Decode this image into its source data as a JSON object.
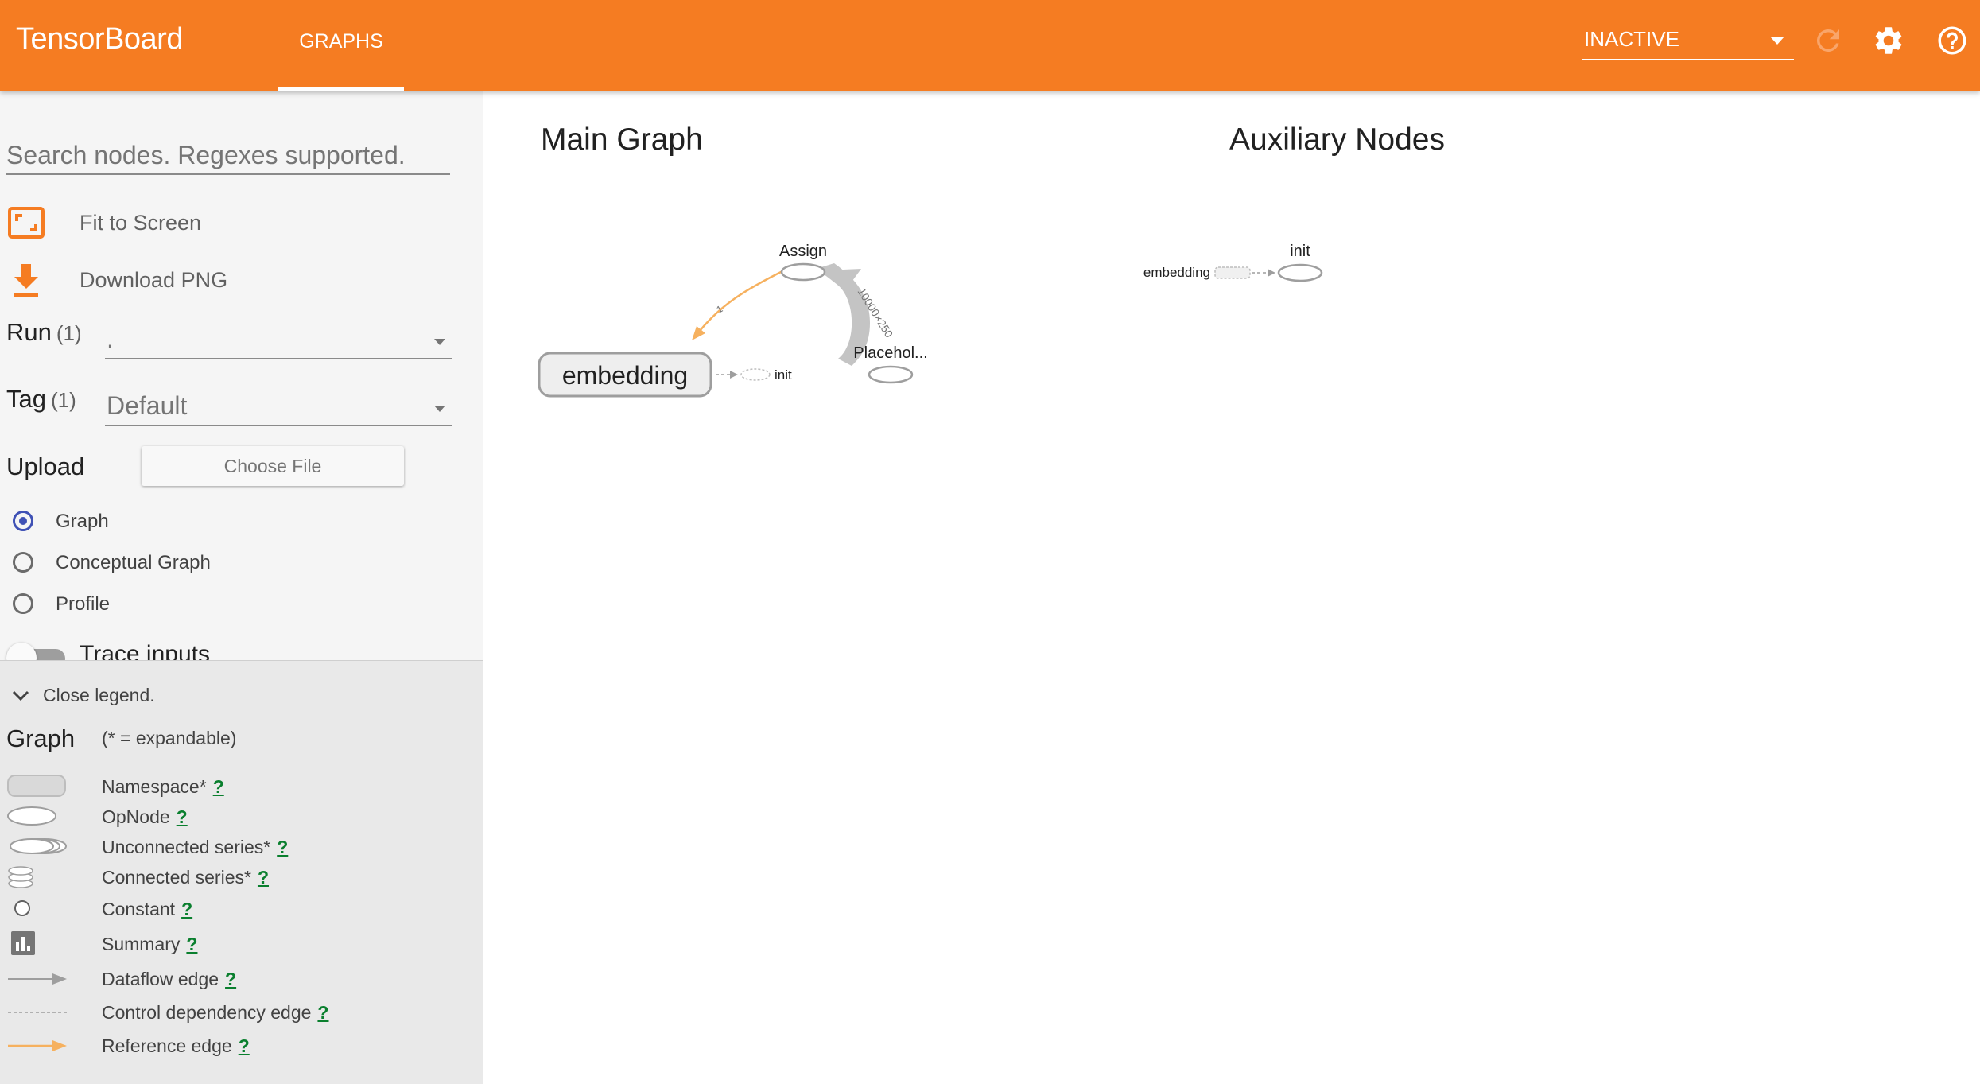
{
  "app": {
    "title": "TensorBoard"
  },
  "tabs": [
    {
      "label": "GRAPHS",
      "active": true
    }
  ],
  "topbar": {
    "run_selector": "INACTIVE",
    "icons": [
      "reload-icon",
      "settings-icon",
      "help-icon"
    ]
  },
  "sidebar": {
    "search_placeholder": "Search nodes. Regexes supported.",
    "fit_to_screen": "Fit to Screen",
    "download_png": "Download PNG",
    "run": {
      "label": "Run",
      "count": "(1)",
      "value": "."
    },
    "tag": {
      "label": "Tag",
      "count": "(1)",
      "value": "Default"
    },
    "upload": {
      "label": "Upload",
      "button": "Choose File"
    },
    "graph_types": [
      {
        "label": "Graph",
        "selected": true
      },
      {
        "label": "Conceptual Graph",
        "selected": false
      },
      {
        "label": "Profile",
        "selected": false
      }
    ],
    "trace_inputs": "Trace inputs"
  },
  "legend": {
    "toggle": "Close legend.",
    "title": "Graph",
    "subtitle": "(* = expandable)",
    "help_mark": "?",
    "items": [
      {
        "label": "Namespace*",
        "symbol": "namespace"
      },
      {
        "label": "OpNode",
        "symbol": "opnode"
      },
      {
        "label": "Unconnected series*",
        "symbol": "unconnected-series"
      },
      {
        "label": "Connected series*",
        "symbol": "connected-series"
      },
      {
        "label": "Constant",
        "symbol": "constant"
      },
      {
        "label": "Summary",
        "symbol": "summary"
      },
      {
        "label": "Dataflow edge",
        "symbol": "dataflow-edge"
      },
      {
        "label": "Control dependency edge",
        "symbol": "control-edge"
      },
      {
        "label": "Reference edge",
        "symbol": "reference-edge"
      }
    ]
  },
  "graph": {
    "main_title": "Main Graph",
    "aux_title": "Auxiliary Nodes",
    "nodes": {
      "assign": "Assign",
      "embedding": "embedding",
      "placeholder": "Placehol...",
      "init": "init"
    },
    "edge_labels": {
      "reference": "1",
      "dataflow": "10000×250"
    },
    "aux_nodes": {
      "embedding": "embedding",
      "init": "init"
    }
  },
  "colors": {
    "accent": "#f57c22",
    "reference_edge": "#f6b15f",
    "dataflow_edge": "#bdbdbd",
    "radio_selected": "#3f51b5",
    "help_link": "#0a7f2e"
  }
}
